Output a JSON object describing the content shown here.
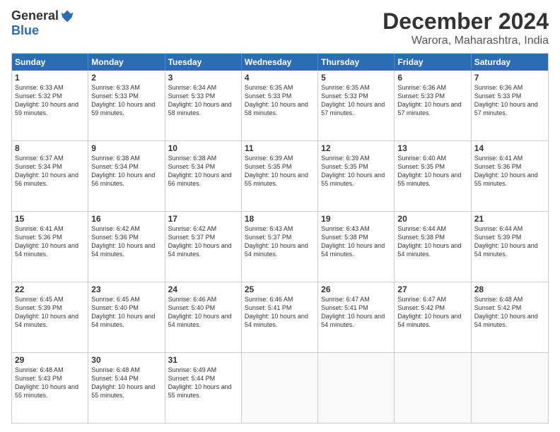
{
  "logo": {
    "general": "General",
    "blue": "Blue"
  },
  "title": "December 2024",
  "location": "Warora, Maharashtra, India",
  "days": [
    "Sunday",
    "Monday",
    "Tuesday",
    "Wednesday",
    "Thursday",
    "Friday",
    "Saturday"
  ],
  "rows": [
    [
      {
        "day": "1",
        "rise": "Sunrise: 6:33 AM",
        "set": "Sunset: 5:32 PM",
        "daylight": "Daylight: 10 hours and 59 minutes."
      },
      {
        "day": "2",
        "rise": "Sunrise: 6:33 AM",
        "set": "Sunset: 5:33 PM",
        "daylight": "Daylight: 10 hours and 59 minutes."
      },
      {
        "day": "3",
        "rise": "Sunrise: 6:34 AM",
        "set": "Sunset: 5:33 PM",
        "daylight": "Daylight: 10 hours and 58 minutes."
      },
      {
        "day": "4",
        "rise": "Sunrise: 6:35 AM",
        "set": "Sunset: 5:33 PM",
        "daylight": "Daylight: 10 hours and 58 minutes."
      },
      {
        "day": "5",
        "rise": "Sunrise: 6:35 AM",
        "set": "Sunset: 5:33 PM",
        "daylight": "Daylight: 10 hours and 57 minutes."
      },
      {
        "day": "6",
        "rise": "Sunrise: 6:36 AM",
        "set": "Sunset: 5:33 PM",
        "daylight": "Daylight: 10 hours and 57 minutes."
      },
      {
        "day": "7",
        "rise": "Sunrise: 6:36 AM",
        "set": "Sunset: 5:33 PM",
        "daylight": "Daylight: 10 hours and 57 minutes."
      }
    ],
    [
      {
        "day": "8",
        "rise": "Sunrise: 6:37 AM",
        "set": "Sunset: 5:34 PM",
        "daylight": "Daylight: 10 hours and 56 minutes."
      },
      {
        "day": "9",
        "rise": "Sunrise: 6:38 AM",
        "set": "Sunset: 5:34 PM",
        "daylight": "Daylight: 10 hours and 56 minutes."
      },
      {
        "day": "10",
        "rise": "Sunrise: 6:38 AM",
        "set": "Sunset: 5:34 PM",
        "daylight": "Daylight: 10 hours and 56 minutes."
      },
      {
        "day": "11",
        "rise": "Sunrise: 6:39 AM",
        "set": "Sunset: 5:35 PM",
        "daylight": "Daylight: 10 hours and 55 minutes."
      },
      {
        "day": "12",
        "rise": "Sunrise: 6:39 AM",
        "set": "Sunset: 5:35 PM",
        "daylight": "Daylight: 10 hours and 55 minutes."
      },
      {
        "day": "13",
        "rise": "Sunrise: 6:40 AM",
        "set": "Sunset: 5:35 PM",
        "daylight": "Daylight: 10 hours and 55 minutes."
      },
      {
        "day": "14",
        "rise": "Sunrise: 6:41 AM",
        "set": "Sunset: 5:36 PM",
        "daylight": "Daylight: 10 hours and 55 minutes."
      }
    ],
    [
      {
        "day": "15",
        "rise": "Sunrise: 6:41 AM",
        "set": "Sunset: 5:36 PM",
        "daylight": "Daylight: 10 hours and 54 minutes."
      },
      {
        "day": "16",
        "rise": "Sunrise: 6:42 AM",
        "set": "Sunset: 5:36 PM",
        "daylight": "Daylight: 10 hours and 54 minutes."
      },
      {
        "day": "17",
        "rise": "Sunrise: 6:42 AM",
        "set": "Sunset: 5:37 PM",
        "daylight": "Daylight: 10 hours and 54 minutes."
      },
      {
        "day": "18",
        "rise": "Sunrise: 6:43 AM",
        "set": "Sunset: 5:37 PM",
        "daylight": "Daylight: 10 hours and 54 minutes."
      },
      {
        "day": "19",
        "rise": "Sunrise: 6:43 AM",
        "set": "Sunset: 5:38 PM",
        "daylight": "Daylight: 10 hours and 54 minutes."
      },
      {
        "day": "20",
        "rise": "Sunrise: 6:44 AM",
        "set": "Sunset: 5:38 PM",
        "daylight": "Daylight: 10 hours and 54 minutes."
      },
      {
        "day": "21",
        "rise": "Sunrise: 6:44 AM",
        "set": "Sunset: 5:39 PM",
        "daylight": "Daylight: 10 hours and 54 minutes."
      }
    ],
    [
      {
        "day": "22",
        "rise": "Sunrise: 6:45 AM",
        "set": "Sunset: 5:39 PM",
        "daylight": "Daylight: 10 hours and 54 minutes."
      },
      {
        "day": "23",
        "rise": "Sunrise: 6:45 AM",
        "set": "Sunset: 5:40 PM",
        "daylight": "Daylight: 10 hours and 54 minutes."
      },
      {
        "day": "24",
        "rise": "Sunrise: 6:46 AM",
        "set": "Sunset: 5:40 PM",
        "daylight": "Daylight: 10 hours and 54 minutes."
      },
      {
        "day": "25",
        "rise": "Sunrise: 6:46 AM",
        "set": "Sunset: 5:41 PM",
        "daylight": "Daylight: 10 hours and 54 minutes."
      },
      {
        "day": "26",
        "rise": "Sunrise: 6:47 AM",
        "set": "Sunset: 5:41 PM",
        "daylight": "Daylight: 10 hours and 54 minutes."
      },
      {
        "day": "27",
        "rise": "Sunrise: 6:47 AM",
        "set": "Sunset: 5:42 PM",
        "daylight": "Daylight: 10 hours and 54 minutes."
      },
      {
        "day": "28",
        "rise": "Sunrise: 6:48 AM",
        "set": "Sunset: 5:42 PM",
        "daylight": "Daylight: 10 hours and 54 minutes."
      }
    ],
    [
      {
        "day": "29",
        "rise": "Sunrise: 6:48 AM",
        "set": "Sunset: 5:43 PM",
        "daylight": "Daylight: 10 hours and 55 minutes."
      },
      {
        "day": "30",
        "rise": "Sunrise: 6:48 AM",
        "set": "Sunset: 5:44 PM",
        "daylight": "Daylight: 10 hours and 55 minutes."
      },
      {
        "day": "31",
        "rise": "Sunrise: 6:49 AM",
        "set": "Sunset: 5:44 PM",
        "daylight": "Daylight: 10 hours and 55 minutes."
      },
      null,
      null,
      null,
      null
    ]
  ]
}
